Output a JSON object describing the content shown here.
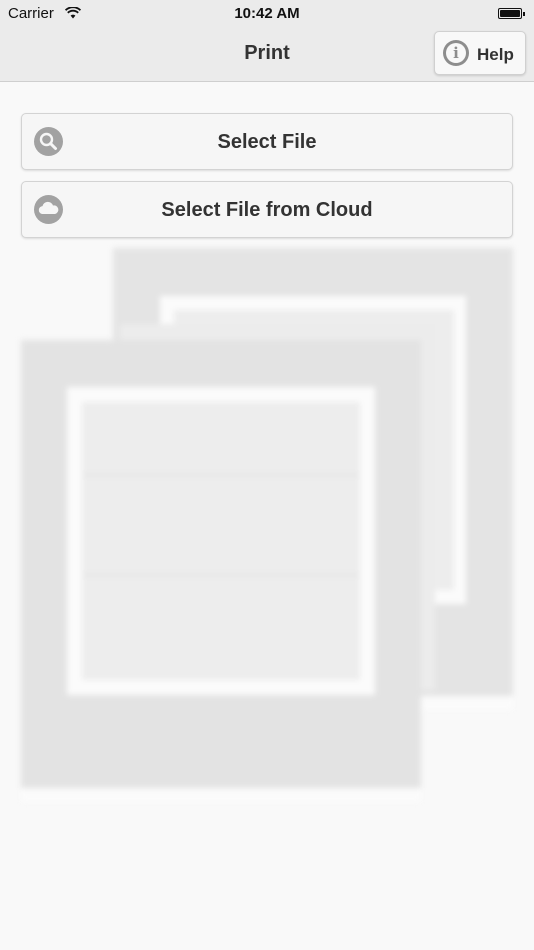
{
  "status_bar": {
    "carrier": "Carrier",
    "time": "10:42 AM",
    "icons": [
      "wifi-icon",
      "battery-icon"
    ]
  },
  "nav": {
    "title": "Print",
    "help_label": "Help",
    "help_icon": "info-icon"
  },
  "actions": [
    {
      "label": "Select File",
      "icon": "search-icon"
    },
    {
      "label": "Select File from Cloud",
      "icon": "cloud-icon"
    }
  ],
  "colors": {
    "background": "#f9f9f9",
    "bar": "#ebebeb",
    "icon_gray": "#a2a2a2",
    "text": "#333333"
  }
}
